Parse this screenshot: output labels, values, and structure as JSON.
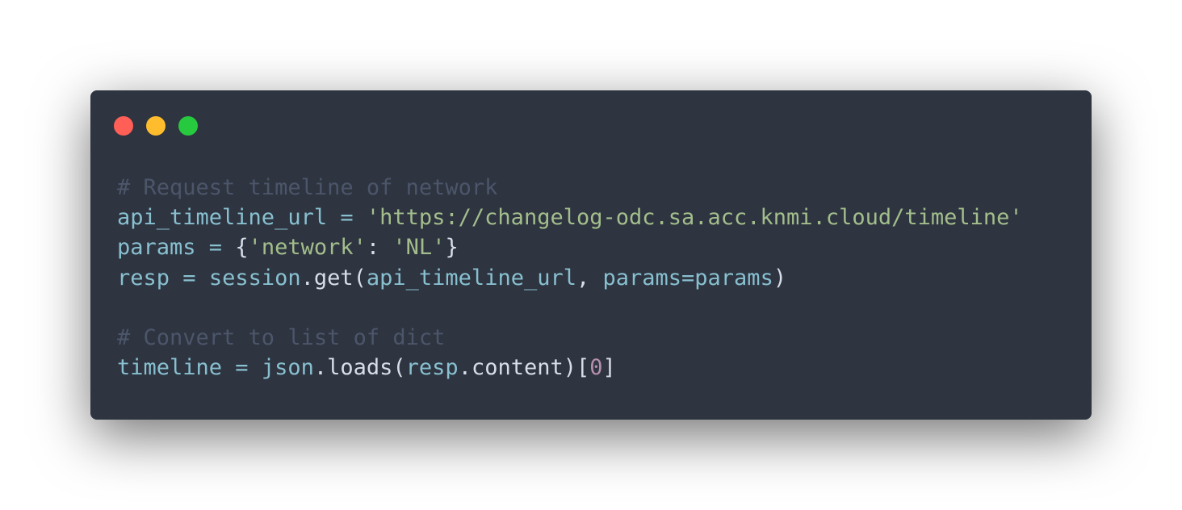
{
  "window": {
    "background": "#2e3440",
    "controls": [
      {
        "name": "close-button",
        "color": "#ff5f56"
      },
      {
        "name": "minimize-button",
        "color": "#ffbd2e"
      },
      {
        "name": "maximize-button",
        "color": "#27c93f"
      }
    ]
  },
  "colors": {
    "comment": "#4c566a",
    "variable": "#88c0d0",
    "string": "#a3be8c",
    "number": "#b48ead",
    "punctuation": "#d8dee9",
    "function": "#d8dee9"
  },
  "code": {
    "lines": [
      [
        {
          "t": "# Request timeline of network",
          "c": "comment"
        }
      ],
      [
        {
          "t": "api_timeline_url",
          "c": "variable"
        },
        {
          "t": " = ",
          "c": "variable"
        },
        {
          "t": "'https://changelog-odc.sa.acc.knmi.cloud/timeline'",
          "c": "string"
        }
      ],
      [
        {
          "t": "params",
          "c": "variable"
        },
        {
          "t": " = ",
          "c": "variable"
        },
        {
          "t": "{",
          "c": "punctuation"
        },
        {
          "t": "'network'",
          "c": "string"
        },
        {
          "t": ": ",
          "c": "punctuation"
        },
        {
          "t": "'NL'",
          "c": "string"
        },
        {
          "t": "}",
          "c": "punctuation"
        }
      ],
      [
        {
          "t": "resp",
          "c": "variable"
        },
        {
          "t": " = ",
          "c": "variable"
        },
        {
          "t": "session",
          "c": "variable"
        },
        {
          "t": ".get(",
          "c": "function"
        },
        {
          "t": "api_timeline_url",
          "c": "variable"
        },
        {
          "t": ", ",
          "c": "punctuation"
        },
        {
          "t": "params=params",
          "c": "variable"
        },
        {
          "t": ")",
          "c": "punctuation"
        }
      ],
      [],
      [
        {
          "t": "# Convert to list of dict",
          "c": "comment"
        }
      ],
      [
        {
          "t": "timeline",
          "c": "variable"
        },
        {
          "t": " = ",
          "c": "variable"
        },
        {
          "t": "json",
          "c": "variable"
        },
        {
          "t": ".loads(",
          "c": "function"
        },
        {
          "t": "resp",
          "c": "variable"
        },
        {
          "t": ".content)[",
          "c": "function"
        },
        {
          "t": "0",
          "c": "number"
        },
        {
          "t": "]",
          "c": "punctuation"
        }
      ]
    ]
  }
}
